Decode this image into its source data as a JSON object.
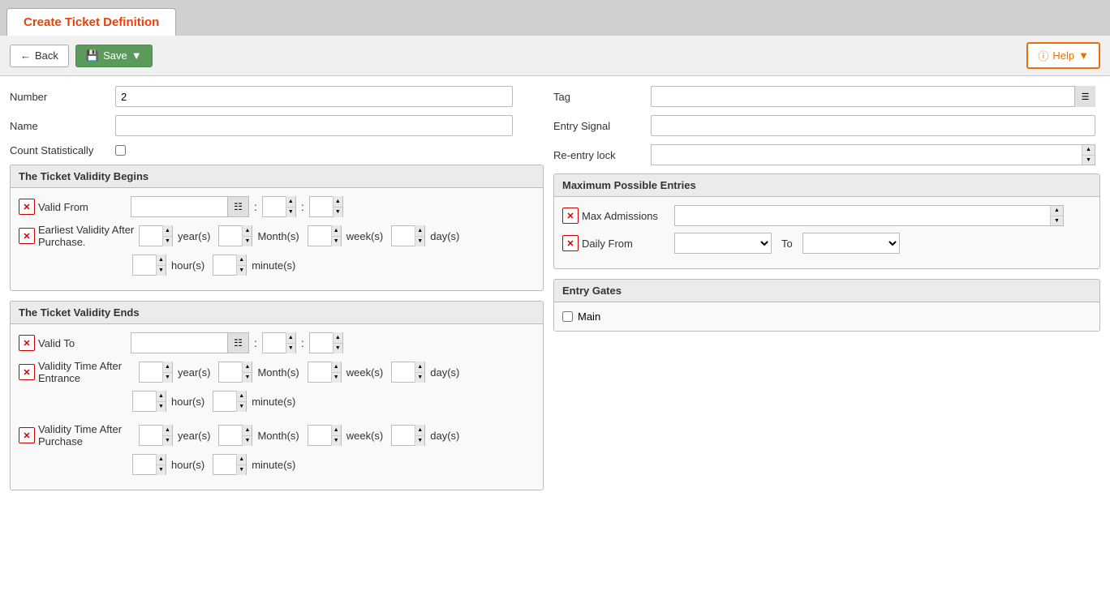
{
  "tab": {
    "label": "Create Ticket Definition"
  },
  "toolbar": {
    "back_label": "Back",
    "save_label": "Save",
    "help_label": "Help"
  },
  "form": {
    "number_label": "Number",
    "number_value": "2",
    "name_label": "Name",
    "name_value": "",
    "count_statistically_label": "Count Statistically",
    "tag_label": "Tag",
    "entry_signal_label": "Entry Signal",
    "reentry_lock_label": "Re-entry lock"
  },
  "validity_begins": {
    "title": "The Ticket Validity Begins",
    "valid_from_label": "Valid From",
    "earliest_validity_label": "Earliest Validity After Purchase.",
    "year_label": "year(s)",
    "month_label": "Month(s)",
    "week_label": "week(s)",
    "day_label": "day(s)",
    "hour_label": "hour(s)",
    "minute_label": "minute(s)"
  },
  "validity_ends": {
    "title": "The Ticket Validity Ends",
    "valid_to_label": "Valid To",
    "validity_time_entrance_label": "Validity Time After Entrance",
    "validity_time_purchase_label": "Validity Time After Purchase",
    "year_label": "year(s)",
    "month_label": "Month(s)",
    "week_label": "week(s)",
    "day_label": "day(s)",
    "hour_label": "hour(s)",
    "minute_label": "minute(s)"
  },
  "maximum_possible_entries": {
    "title": "Maximum Possible Entries",
    "max_admissions_label": "Max Admissions",
    "daily_from_label": "Daily From",
    "to_label": "To"
  },
  "entry_gates": {
    "title": "Entry Gates",
    "main_label": "Main"
  }
}
